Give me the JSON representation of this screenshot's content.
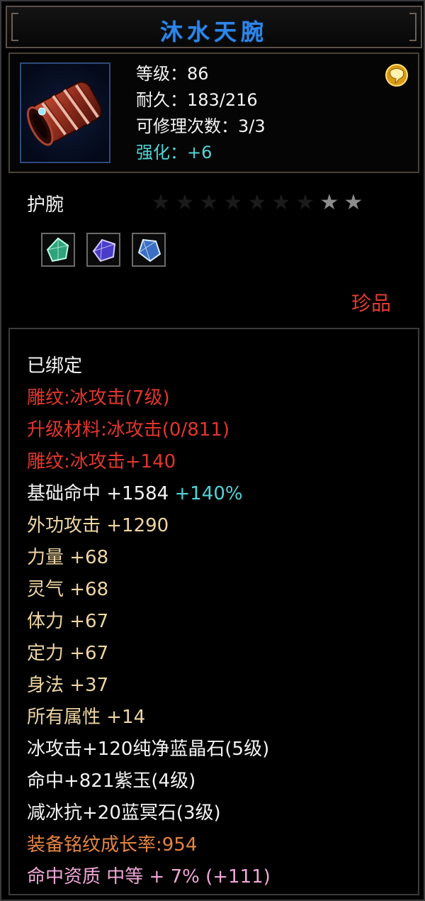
{
  "tooltip": {
    "title": "沐水天腕",
    "header": {
      "level_line": "等级：86",
      "durability_line": "耐久：183/216",
      "repair_line": "可修理次数：3/3",
      "enhance_line": "强化：+6"
    },
    "item_type": "护腕",
    "stars": {
      "total": 9,
      "lit": 2
    },
    "gems": [
      "green-gem-icon",
      "purple-gem-icon",
      "blue-gem-icon"
    ],
    "quality": "珍品",
    "lines": {
      "bound": "已绑定",
      "engrave_level": "雕纹:冰攻击(7级)",
      "upgrade_material": "升级材料:冰攻击(0/811)",
      "engrave_bonus": "雕纹:冰攻击+140",
      "hit_label": "基础命中 +1584",
      "hit_extra": " +140%",
      "external_attack": "外功攻击 +1290",
      "strength": "力量 +68",
      "spirit": "灵气 +68",
      "stamina": "体力 +67",
      "focus": "定力 +67",
      "agility": "身法 +37",
      "all_attributes": "所有属性 +14",
      "gem1": "冰攻击+120纯净蓝晶石(5级)",
      "gem2": "命中+821紫玉(4级)",
      "gem3": "减冰抗+20蓝冥石(3级)",
      "growth_rate": "装备铭纹成长率:954",
      "aptitude_label": "命中资质 ",
      "aptitude_value": "中等 + 7% (+111)"
    },
    "colors": {
      "title": "#2e86e8",
      "red": "#e2362c",
      "beige": "#efd6a2",
      "cyan": "#52d3d9",
      "orange": "#e58542",
      "pink": "#f0a8d8"
    }
  }
}
